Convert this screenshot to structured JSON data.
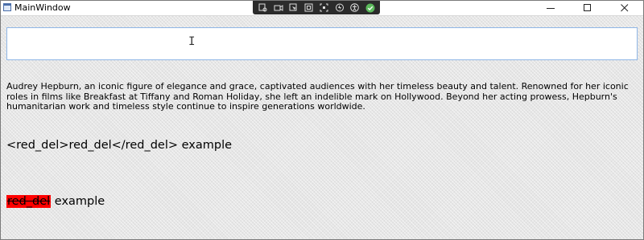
{
  "window": {
    "title": "MainWindow",
    "controls": {
      "minimize": "minimize-icon",
      "maximize": "maximize-icon",
      "close": "close-icon"
    }
  },
  "debug_toolbar": {
    "tools": [
      "live-visual-tree-icon",
      "recording-icon",
      "select-element-icon",
      "adorner-icon",
      "track-focus-icon",
      "hot-reload-icon",
      "accessibility-icon",
      "binding-check-icon"
    ]
  },
  "input": {
    "value": ""
  },
  "content": {
    "paragraph": "Audrey Hepburn, an iconic figure of elegance and grace, captivated audiences with her timeless beauty and talent. Renowned for her iconic roles in films like Breakfast at Tiffany and Roman Holiday, she left an indelible mark on Hollywood. Beyond her acting prowess, Hepburn's humanitarian work and timeless style continue to inspire generations worldwide.",
    "tag_example": "<red_del>red_del</red_del> example",
    "del_word": "red_del",
    "del_suffix": " example"
  },
  "colors": {
    "highlight": "#ff0000",
    "focus_border": "#8fb6e6"
  }
}
